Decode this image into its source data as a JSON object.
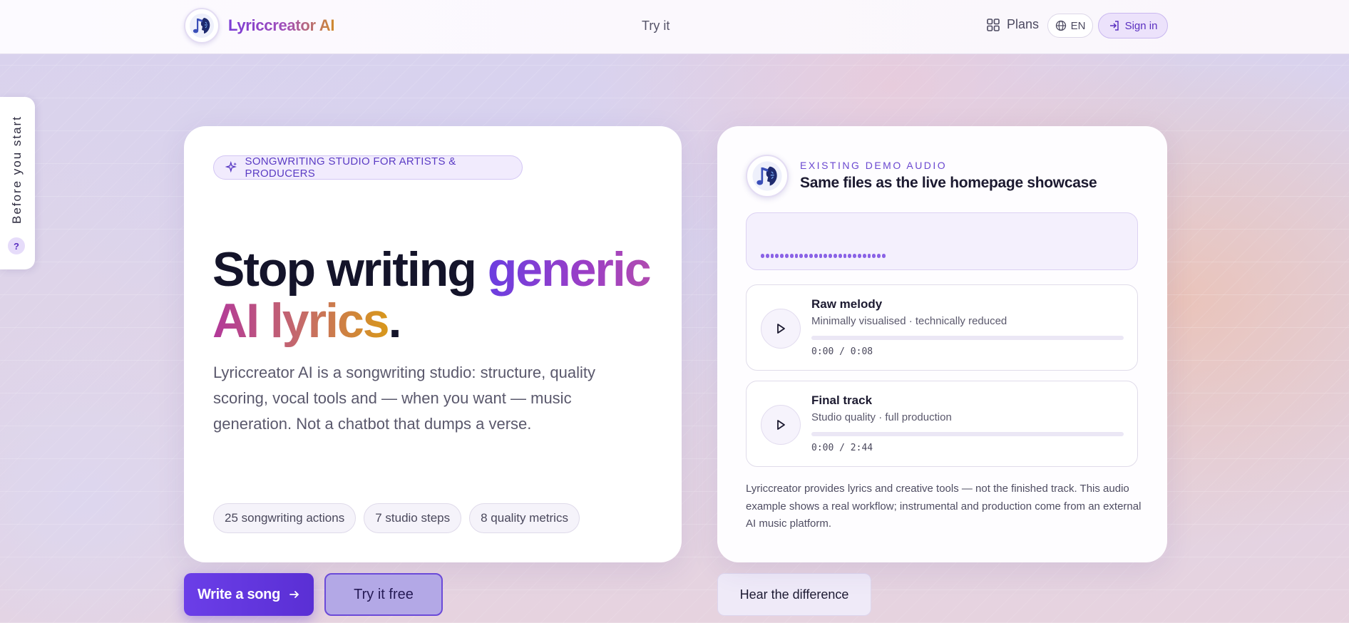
{
  "header": {
    "brand": "Lyriccreator AI",
    "nav_try": "Try it",
    "plans_label": "Plans",
    "lang_label": "EN",
    "signin_label": "Sign in"
  },
  "side_tab": {
    "label": "Before you start",
    "help": "?"
  },
  "hero": {
    "badge": "SONGWRITING STUDIO FOR ARTISTS & PRODUCERS",
    "headline_part1": "Stop writing ",
    "headline_part2": "generic",
    "headline_part3": "AI lyrics",
    "headline_part4": ".",
    "lead": "Lyriccreator AI is a songwriting studio: structure, quality scoring, vocal tools and — when you want — music generation. Not a chatbot that dumps a verse.",
    "stats": [
      "25 songwriting actions",
      "7 studio steps",
      "8 quality metrics"
    ]
  },
  "cta": {
    "primary": "Write a song",
    "secondary": "Try it free",
    "tertiary": "Hear the difference"
  },
  "demo": {
    "eyebrow": "EXISTING DEMO AUDIO",
    "title": "Same files as the live homepage showcase",
    "tracks": [
      {
        "name": "Raw melody",
        "subtitle": "Minimally visualised · technically reduced",
        "time": "0:00 / 0:08",
        "progress": 0
      },
      {
        "name": "Final track",
        "subtitle": "Studio quality · full production",
        "time": "0:00 / 2:44",
        "progress": 0
      }
    ],
    "disclaimer": "Lyriccreator provides lyrics and creative tools — not the finished track. This audio example shows a real workflow; instrumental and production come from an external AI music platform."
  },
  "colors": {
    "accent": "#5a2fd4",
    "accent_light": "#ece2fb",
    "brand_gradient_start": "#7a3bd6",
    "brand_gradient_end": "#d08a2e"
  },
  "icons": {
    "logo": "music-note-head-icon",
    "plans": "grid-icon",
    "lang": "globe-icon",
    "signin": "sign-in-icon",
    "badge": "sparkle-icon",
    "cta_arrow": "arrow-right-icon",
    "play": "play-icon"
  }
}
